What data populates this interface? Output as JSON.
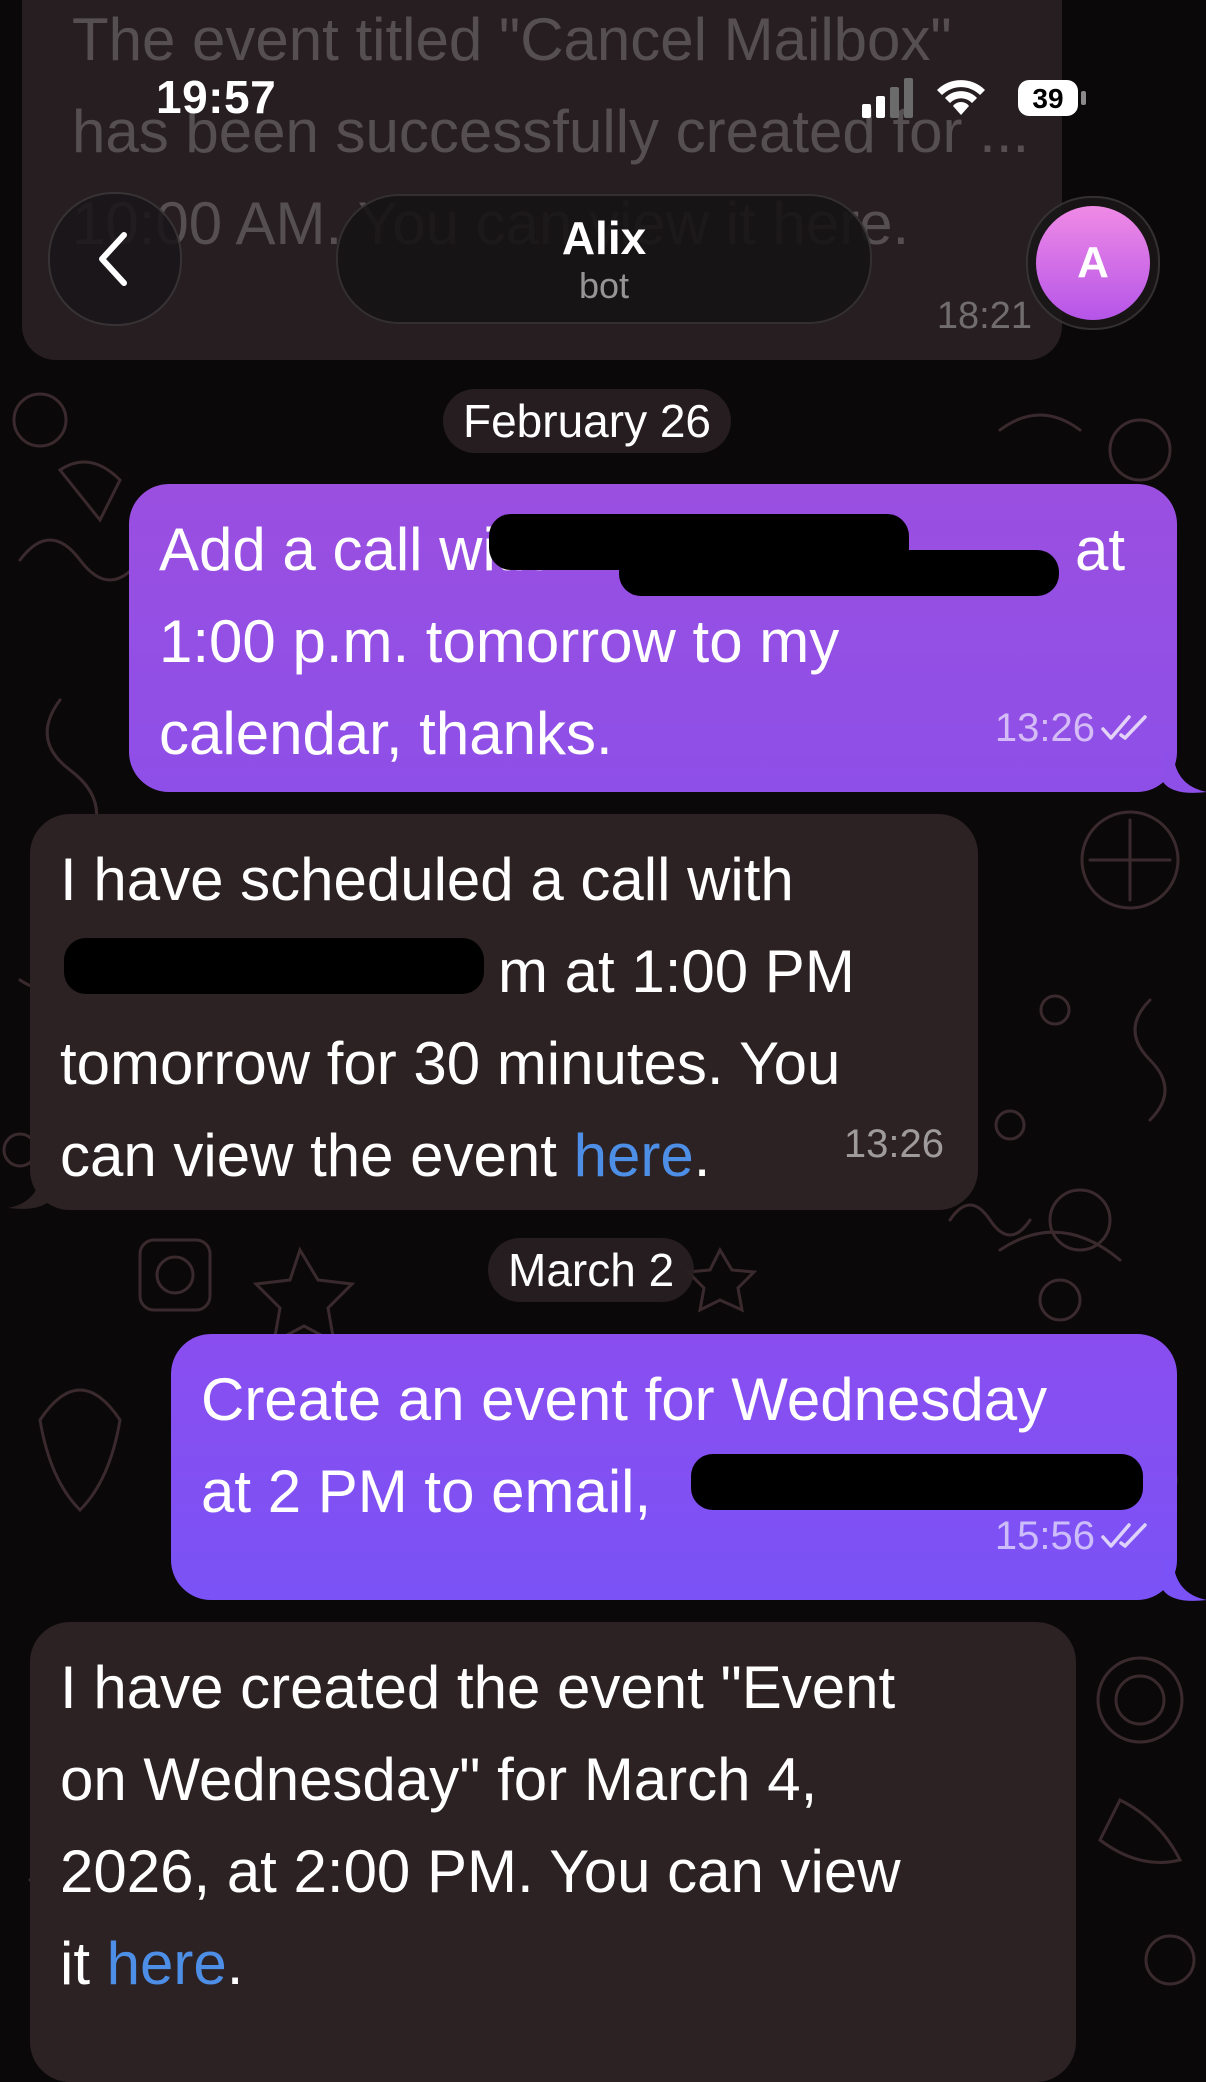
{
  "status_bar": {
    "time": "19:57",
    "battery": "39"
  },
  "background_message": {
    "text": "The event titled \"Cancel Mailbox\" has been successfully created for ... 10:00 AM. You can view it here.",
    "time": "18:21"
  },
  "header": {
    "name": "Alix",
    "subtitle": "bot",
    "avatar_letter": "A"
  },
  "messages": [
    {
      "kind": "date",
      "text": "February 26"
    },
    {
      "kind": "out",
      "lines": [
        "Add a call with ",
        "at",
        "1:00 p.m. tomorrow to my",
        "calendar, thanks."
      ],
      "time": "13:26",
      "status": "read"
    },
    {
      "kind": "in",
      "lines": [
        "I have scheduled a call with",
        "m at 1:00 PM",
        "tomorrow for 30 minutes. You",
        "can view the event "
      ],
      "link": "here",
      "end": ".",
      "time": "13:26"
    },
    {
      "kind": "date",
      "text": "March 2"
    },
    {
      "kind": "out",
      "lines": [
        "Create an event for Wednesday",
        "at 2 PM to email, "
      ],
      "time": "15:56",
      "status": "read"
    },
    {
      "kind": "in",
      "lines": [
        "I have created the event \"Event",
        "on Wednesday\" for March 4,",
        "2026, at 2:00 PM. You can view",
        "it "
      ],
      "link": "here",
      "end": "."
    }
  ],
  "colors": {
    "background": "#0b0809",
    "outgoing_top": "#9a4fe0",
    "outgoing_bottom": "#7a52f5",
    "incoming": "#2c2224",
    "link": "#4d8fe6",
    "avatar": "#d16fe8"
  },
  "icons": {
    "back": "chevron-left-icon",
    "signal": "cellular-signal-icon",
    "wifi": "wifi-icon",
    "battery": "battery-icon",
    "read": "double-check-icon"
  }
}
